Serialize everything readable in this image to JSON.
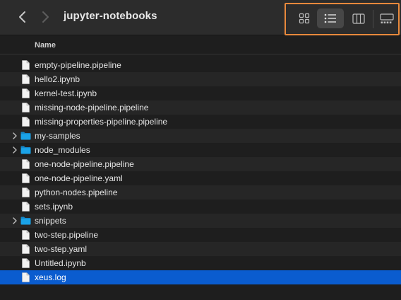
{
  "window": {
    "title": "jupyter-notebooks"
  },
  "toolbar": {
    "back_icon": "chevron-left-icon",
    "forward_icon": "chevron-right-icon",
    "view_modes": [
      {
        "name": "icon-view",
        "icon": "grid-icon",
        "active": false
      },
      {
        "name": "list-view",
        "icon": "list-icon",
        "active": true
      },
      {
        "name": "column-view",
        "icon": "columns-icon",
        "active": false
      },
      {
        "name": "gallery-view",
        "icon": "gallery-icon",
        "active": false
      }
    ],
    "highlight_color": "#e8893c"
  },
  "list": {
    "column_header": "Name",
    "selected_color": "#0a5ccf",
    "folder_color": "#1aa3e8",
    "items": [
      {
        "name": "empty-pipeline.pipeline",
        "kind": "file"
      },
      {
        "name": "hello2.ipynb",
        "kind": "file"
      },
      {
        "name": "kernel-test.ipynb",
        "kind": "file"
      },
      {
        "name": "missing-node-pipeline.pipeline",
        "kind": "file"
      },
      {
        "name": "missing-properties-pipeline.pipeline",
        "kind": "file"
      },
      {
        "name": "my-samples",
        "kind": "folder"
      },
      {
        "name": "node_modules",
        "kind": "folder"
      },
      {
        "name": "one-node-pipeline.pipeline",
        "kind": "file"
      },
      {
        "name": "one-node-pipeline.yaml",
        "kind": "file"
      },
      {
        "name": "python-nodes.pipeline",
        "kind": "file"
      },
      {
        "name": "sets.ipynb",
        "kind": "file"
      },
      {
        "name": "snippets",
        "kind": "folder"
      },
      {
        "name": "two-step.pipeline",
        "kind": "file"
      },
      {
        "name": "two-step.yaml",
        "kind": "file"
      },
      {
        "name": "Untitled.ipynb",
        "kind": "file"
      },
      {
        "name": "xeus.log",
        "kind": "file",
        "selected": true
      }
    ]
  }
}
